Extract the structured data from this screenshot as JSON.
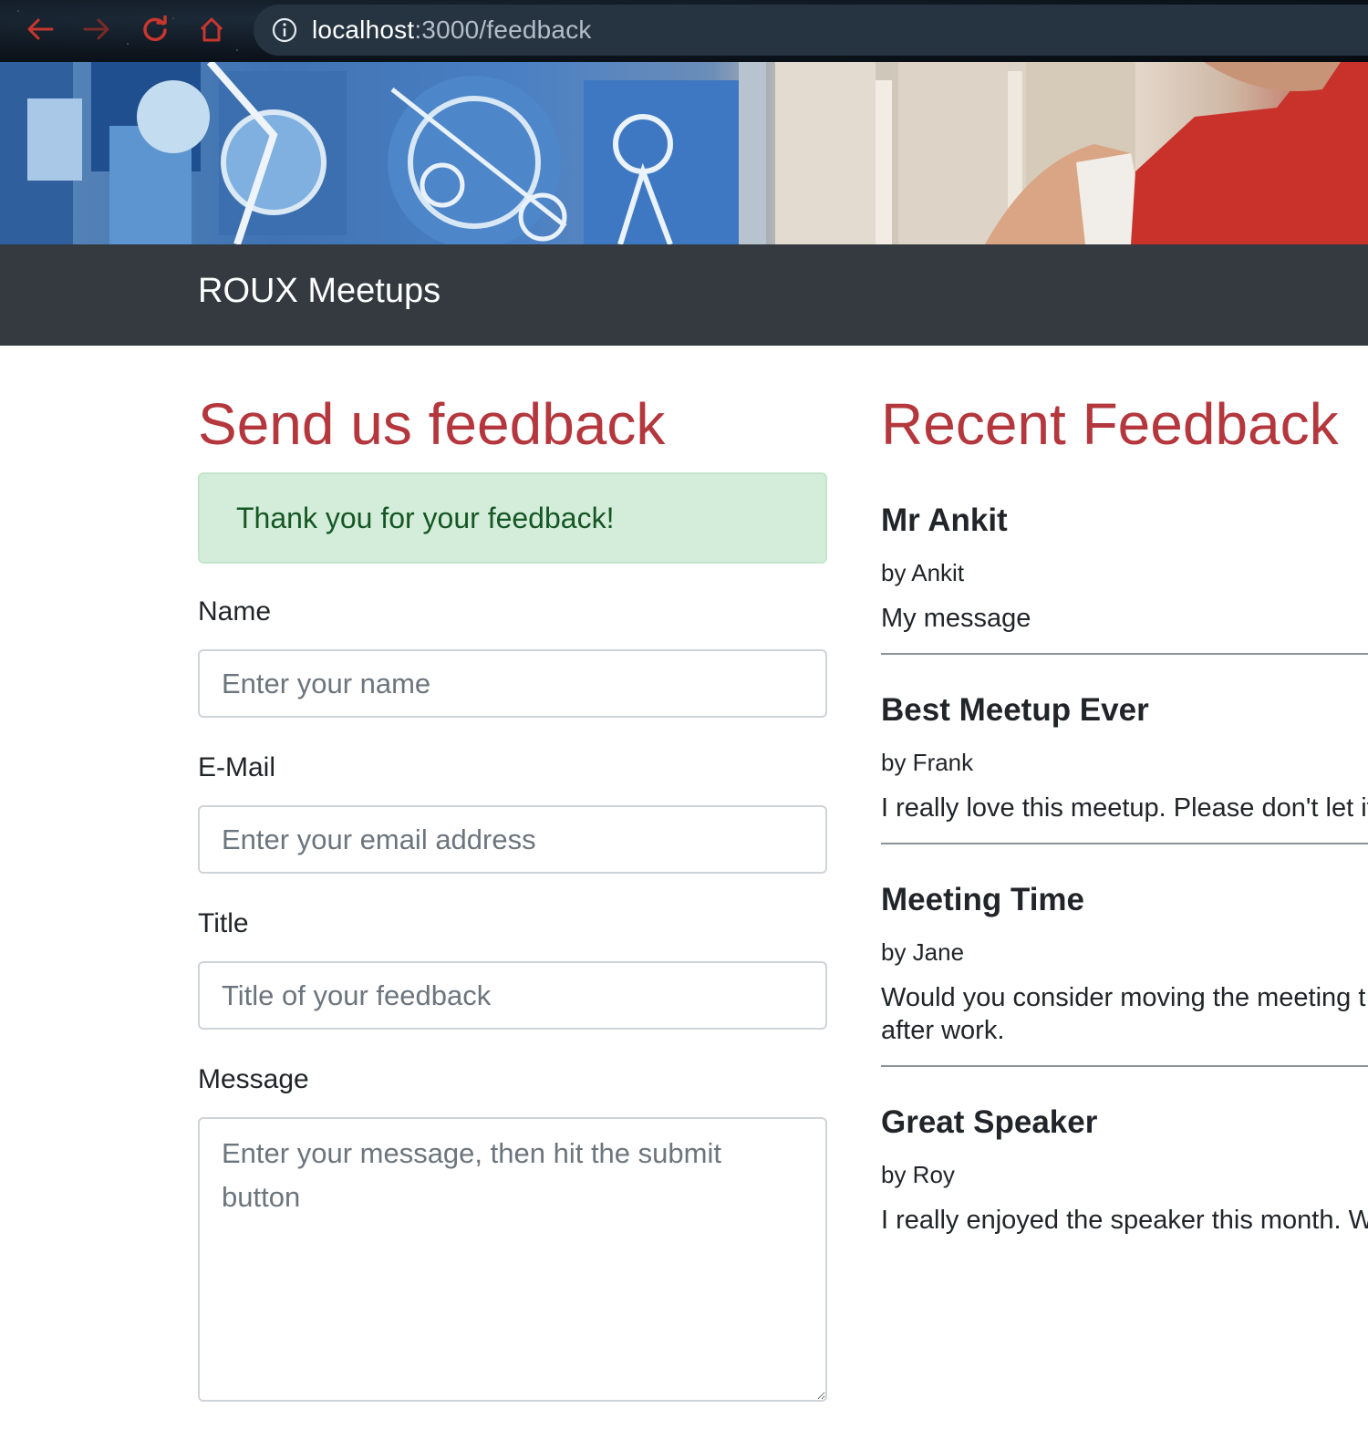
{
  "browser": {
    "url_host": "localhost",
    "url_path": ":3000/feedback"
  },
  "navbar": {
    "brand": "ROUX Meetups"
  },
  "form": {
    "title": "Send us feedback",
    "success_message": "Thank you for your feedback!",
    "name_label": "Name",
    "name_placeholder": "Enter your name",
    "email_label": "E-Mail",
    "email_placeholder": "Enter your email address",
    "title_label": "Title",
    "title_placeholder": "Title of your feedback",
    "message_label": "Message",
    "message_placeholder": "Enter your message, then hit the submit button"
  },
  "recent": {
    "title": "Recent Feedback",
    "items": [
      {
        "title": "Mr Ankit",
        "author": "by Ankit",
        "message": "My message"
      },
      {
        "title": "Best Meetup Ever",
        "author": "by Frank",
        "message": "I really love this meetup. Please don't let it"
      },
      {
        "title": "Meeting Time",
        "author": "by Jane",
        "message": "Would you consider moving the meeting t right after work."
      },
      {
        "title": "Great Speaker",
        "author": "by Roy",
        "message": "I really enjoyed the speaker this month. W"
      }
    ]
  },
  "colors": {
    "accent_red": "#b4373d",
    "navbar_bg": "#343a40",
    "alert_bg": "#d4edda",
    "alert_text": "#155724"
  }
}
